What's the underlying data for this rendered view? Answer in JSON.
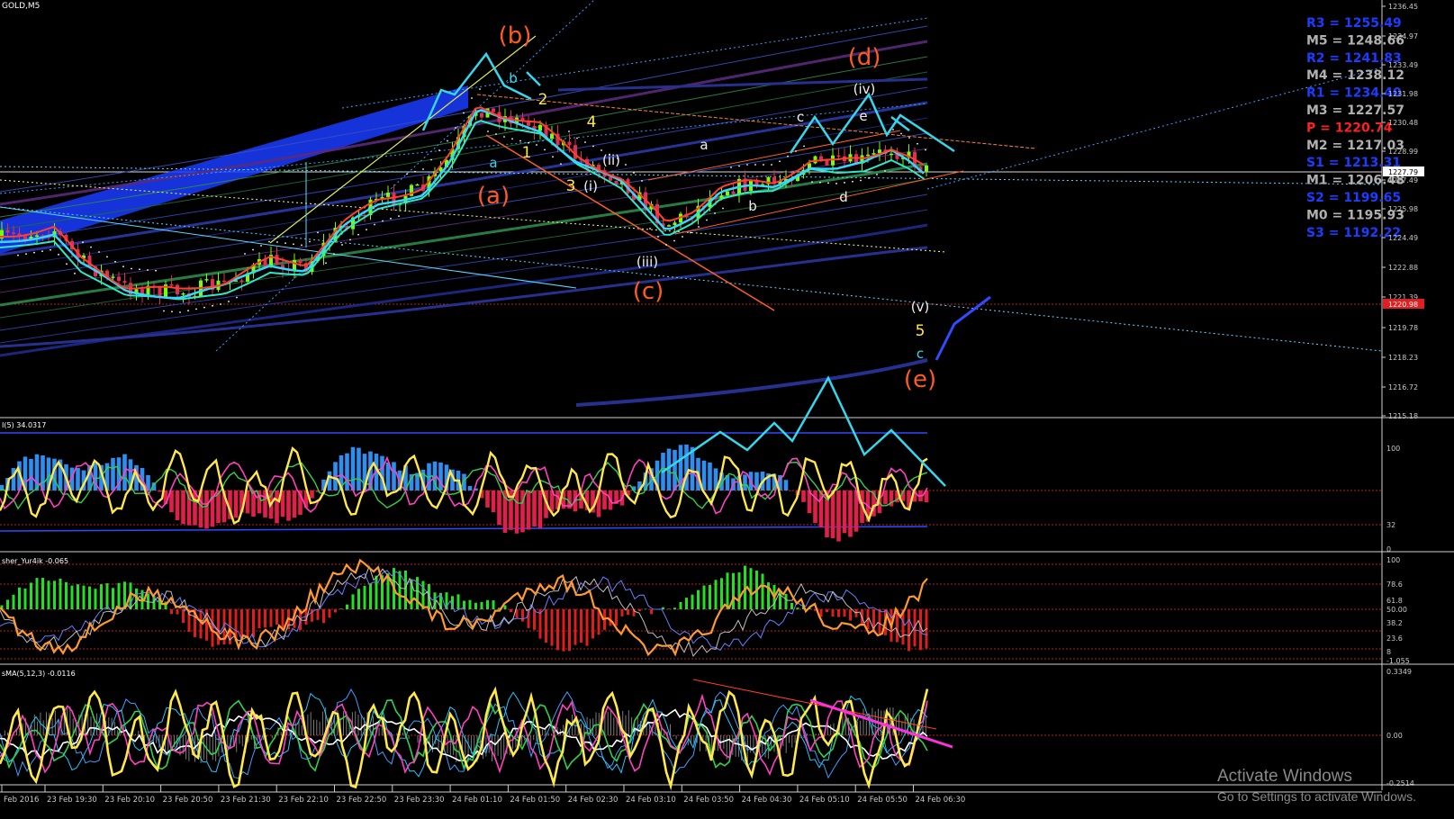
{
  "window": {
    "symbol_title": "GOLD,M5"
  },
  "colors": {
    "background": "#000000",
    "bull_candle": "#7cfc00",
    "bear_candle": "#e03050",
    "wave_orange": "#ff5a1f",
    "wave_yellow": "#ffe84a",
    "wave_cyan": "#35d7ee",
    "pivot_blue": "#1c3cff",
    "pivot_gray": "#b0b0b0",
    "pivot_red": "#ff2020",
    "grid_dotted": "#b82020",
    "axis_text": "#c8c8c8"
  },
  "chart_data": [
    {
      "type": "candlestick",
      "title": "GOLD,M5",
      "y_ticks": [
        "1236.45",
        "1234.97",
        "1233.49",
        "1231.98",
        "1230.48",
        "1228.99",
        "1227.49",
        "1225.98",
        "1224.49",
        "1222.88",
        "1221.39",
        "1219.78",
        "1218.23",
        "1216.72",
        "1215.18"
      ],
      "current_price_label": "1227.79",
      "dotted_level_label": "1220.98",
      "x_ticks": [
        "Feb 2016",
        "23 Feb 19:30",
        "23 Feb 20:10",
        "23 Feb 20:50",
        "23 Feb 21:30",
        "23 Feb 22:10",
        "23 Feb 22:50",
        "23 Feb 23:30",
        "24 Feb 01:10",
        "24 Feb 01:50",
        "24 Feb 02:30",
        "24 Feb 03:10",
        "24 Feb 03:50",
        "24 Feb 04:30",
        "24 Feb 05:10",
        "24 Feb 05:50",
        "24 Feb 06:30"
      ],
      "pivot_levels": [
        {
          "label": "R3",
          "value": "1255.49",
          "role": "r"
        },
        {
          "label": "M5",
          "value": "1248.66",
          "role": "m"
        },
        {
          "label": "R2",
          "value": "1241.83",
          "role": "r"
        },
        {
          "label": "M4",
          "value": "1238.12",
          "role": "m"
        },
        {
          "label": "R1",
          "value": "1234.40",
          "role": "r"
        },
        {
          "label": "M3",
          "value": "1227.57",
          "role": "m"
        },
        {
          "label": "P ",
          "value": "1220.74",
          "role": "p"
        },
        {
          "label": "M2",
          "value": "1217.03",
          "role": "m"
        },
        {
          "label": "S1",
          "value": "1213.31",
          "role": "r"
        },
        {
          "label": "M1",
          "value": "1206.48",
          "role": "m"
        },
        {
          "label": "S2",
          "value": "1199.65",
          "role": "r"
        },
        {
          "label": "M0",
          "value": "1195.93",
          "role": "m"
        },
        {
          "label": "S3",
          "value": "1192.22",
          "role": "r"
        }
      ],
      "wave_labels": [
        {
          "text": "(b)",
          "color": "orange",
          "big": true
        },
        {
          "text": "(d)",
          "color": "orange",
          "big": true
        },
        {
          "text": "(a)",
          "color": "orange",
          "big": true
        },
        {
          "text": "(c)",
          "color": "orange",
          "big": true
        },
        {
          "text": "(e)",
          "color": "orange",
          "big": true
        },
        {
          "text": "(iv)",
          "color": "white"
        },
        {
          "text": "(ii)",
          "color": "white"
        },
        {
          "text": "(i)",
          "color": "white"
        },
        {
          "text": "(iii)",
          "color": "white"
        },
        {
          "text": "(v)",
          "color": "white"
        },
        {
          "text": "2",
          "color": "yellow"
        },
        {
          "text": "4",
          "color": "yellow"
        },
        {
          "text": "3",
          "color": "yellow"
        },
        {
          "text": "1",
          "color": "yellow"
        },
        {
          "text": "5",
          "color": "yellow"
        },
        {
          "text": "a",
          "color": "cyan"
        },
        {
          "text": "b",
          "color": "cyan"
        },
        {
          "text": "c",
          "color": "cyan"
        },
        {
          "text": "a",
          "color": "white"
        },
        {
          "text": "b",
          "color": "white"
        },
        {
          "text": "c",
          "color": "white"
        },
        {
          "text": "d",
          "color": "white"
        },
        {
          "text": "e",
          "color": "white"
        }
      ]
    },
    {
      "type": "bar",
      "title": "I(5) 34.0317",
      "y_ticks": [
        "100",
        "32",
        "0"
      ]
    },
    {
      "type": "bar",
      "title": "sher_Yur4ik -0.065",
      "y_ticks": [
        "100",
        "78.6",
        "61.8",
        "50.00",
        "38.2",
        "23.6",
        "8",
        "-1.055"
      ]
    },
    {
      "type": "line",
      "title": "sMA(5,12,3) -0.0116",
      "y_ticks": [
        "0.3349",
        "0.00",
        "-0.2514"
      ]
    }
  ],
  "watermark": {
    "line1": "Activate Windows",
    "line2": "Go to Settings to activate Windows."
  }
}
